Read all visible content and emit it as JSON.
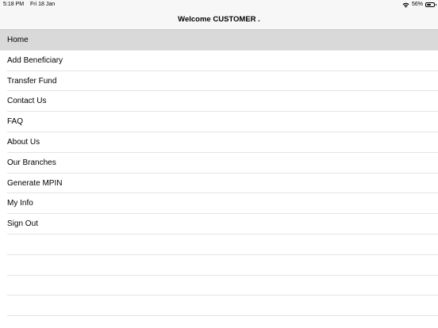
{
  "status_bar": {
    "time": "5:18 PM",
    "date": "Fri 18 Jan",
    "battery_percent": "56%",
    "battery_level": 0.56,
    "wifi_icon": "wifi-icon",
    "battery_icon": "battery-icon"
  },
  "nav": {
    "title": "Welcome CUSTOMER ."
  },
  "menu": {
    "selected_color": "#d9d9d9",
    "items": [
      {
        "label": "Home",
        "selected": true
      },
      {
        "label": "Add Beneficiary"
      },
      {
        "label": "Transfer Fund"
      },
      {
        "label": "Contact Us"
      },
      {
        "label": "FAQ"
      },
      {
        "label": "About Us"
      },
      {
        "label": "Our Branches"
      },
      {
        "label": "Generate MPIN"
      },
      {
        "label": "My Info"
      },
      {
        "label": "Sign Out"
      }
    ]
  }
}
